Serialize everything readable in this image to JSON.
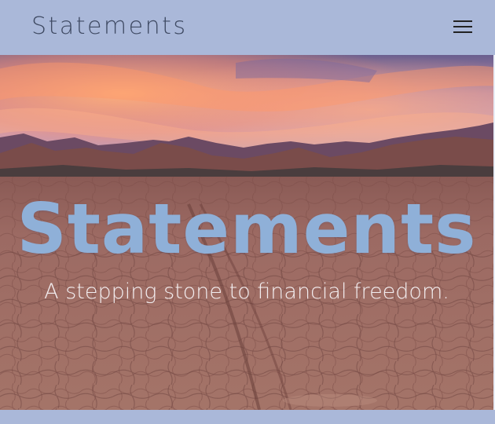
{
  "navbar": {
    "brand": "Statements",
    "menu_icon": "hamburger-menu-icon"
  },
  "hero": {
    "title": "Statements",
    "tagline": "A stepping stone to financial freedom."
  },
  "colors": {
    "navbar_bg": "#aab8d9",
    "brand_text": "#3f4a63",
    "hero_title": "#8fb0d8",
    "hero_tagline": "#f3eef0"
  }
}
